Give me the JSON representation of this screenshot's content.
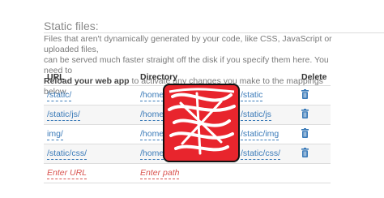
{
  "section": {
    "title": "Static files:",
    "description_line1": "Files that aren't dynamically generated by your code, like CSS, JavaScript or uploaded files,",
    "description_line2": "can be served much faster straight off the disk if you specify them here. You need to",
    "reload_strong": "Reload your web app",
    "description_line3_rest": " to activate any changes you make to the mappings below."
  },
  "table": {
    "headers": {
      "url": "URL",
      "directory": "Directory",
      "delete": "Delete"
    },
    "rows": [
      {
        "url": "/static/",
        "dir_start": "/home",
        "dir_end": "/static"
      },
      {
        "url": "/static/js/",
        "dir_start": "/home",
        "dir_end": "/static/js"
      },
      {
        "url": "img/",
        "dir_start": "/home",
        "dir_end": "/static/img"
      },
      {
        "url": "/static/css/",
        "dir_start": "/home",
        "dir_end": "/static/css/"
      }
    ],
    "new_row": {
      "url_placeholder": "Enter URL",
      "path_placeholder": "Enter path"
    }
  },
  "colors": {
    "link": "#3a7ab8",
    "placeholder_red": "#d9534f",
    "redaction_red": "#e8252d"
  },
  "icons": {
    "delete": "trash-icon"
  }
}
